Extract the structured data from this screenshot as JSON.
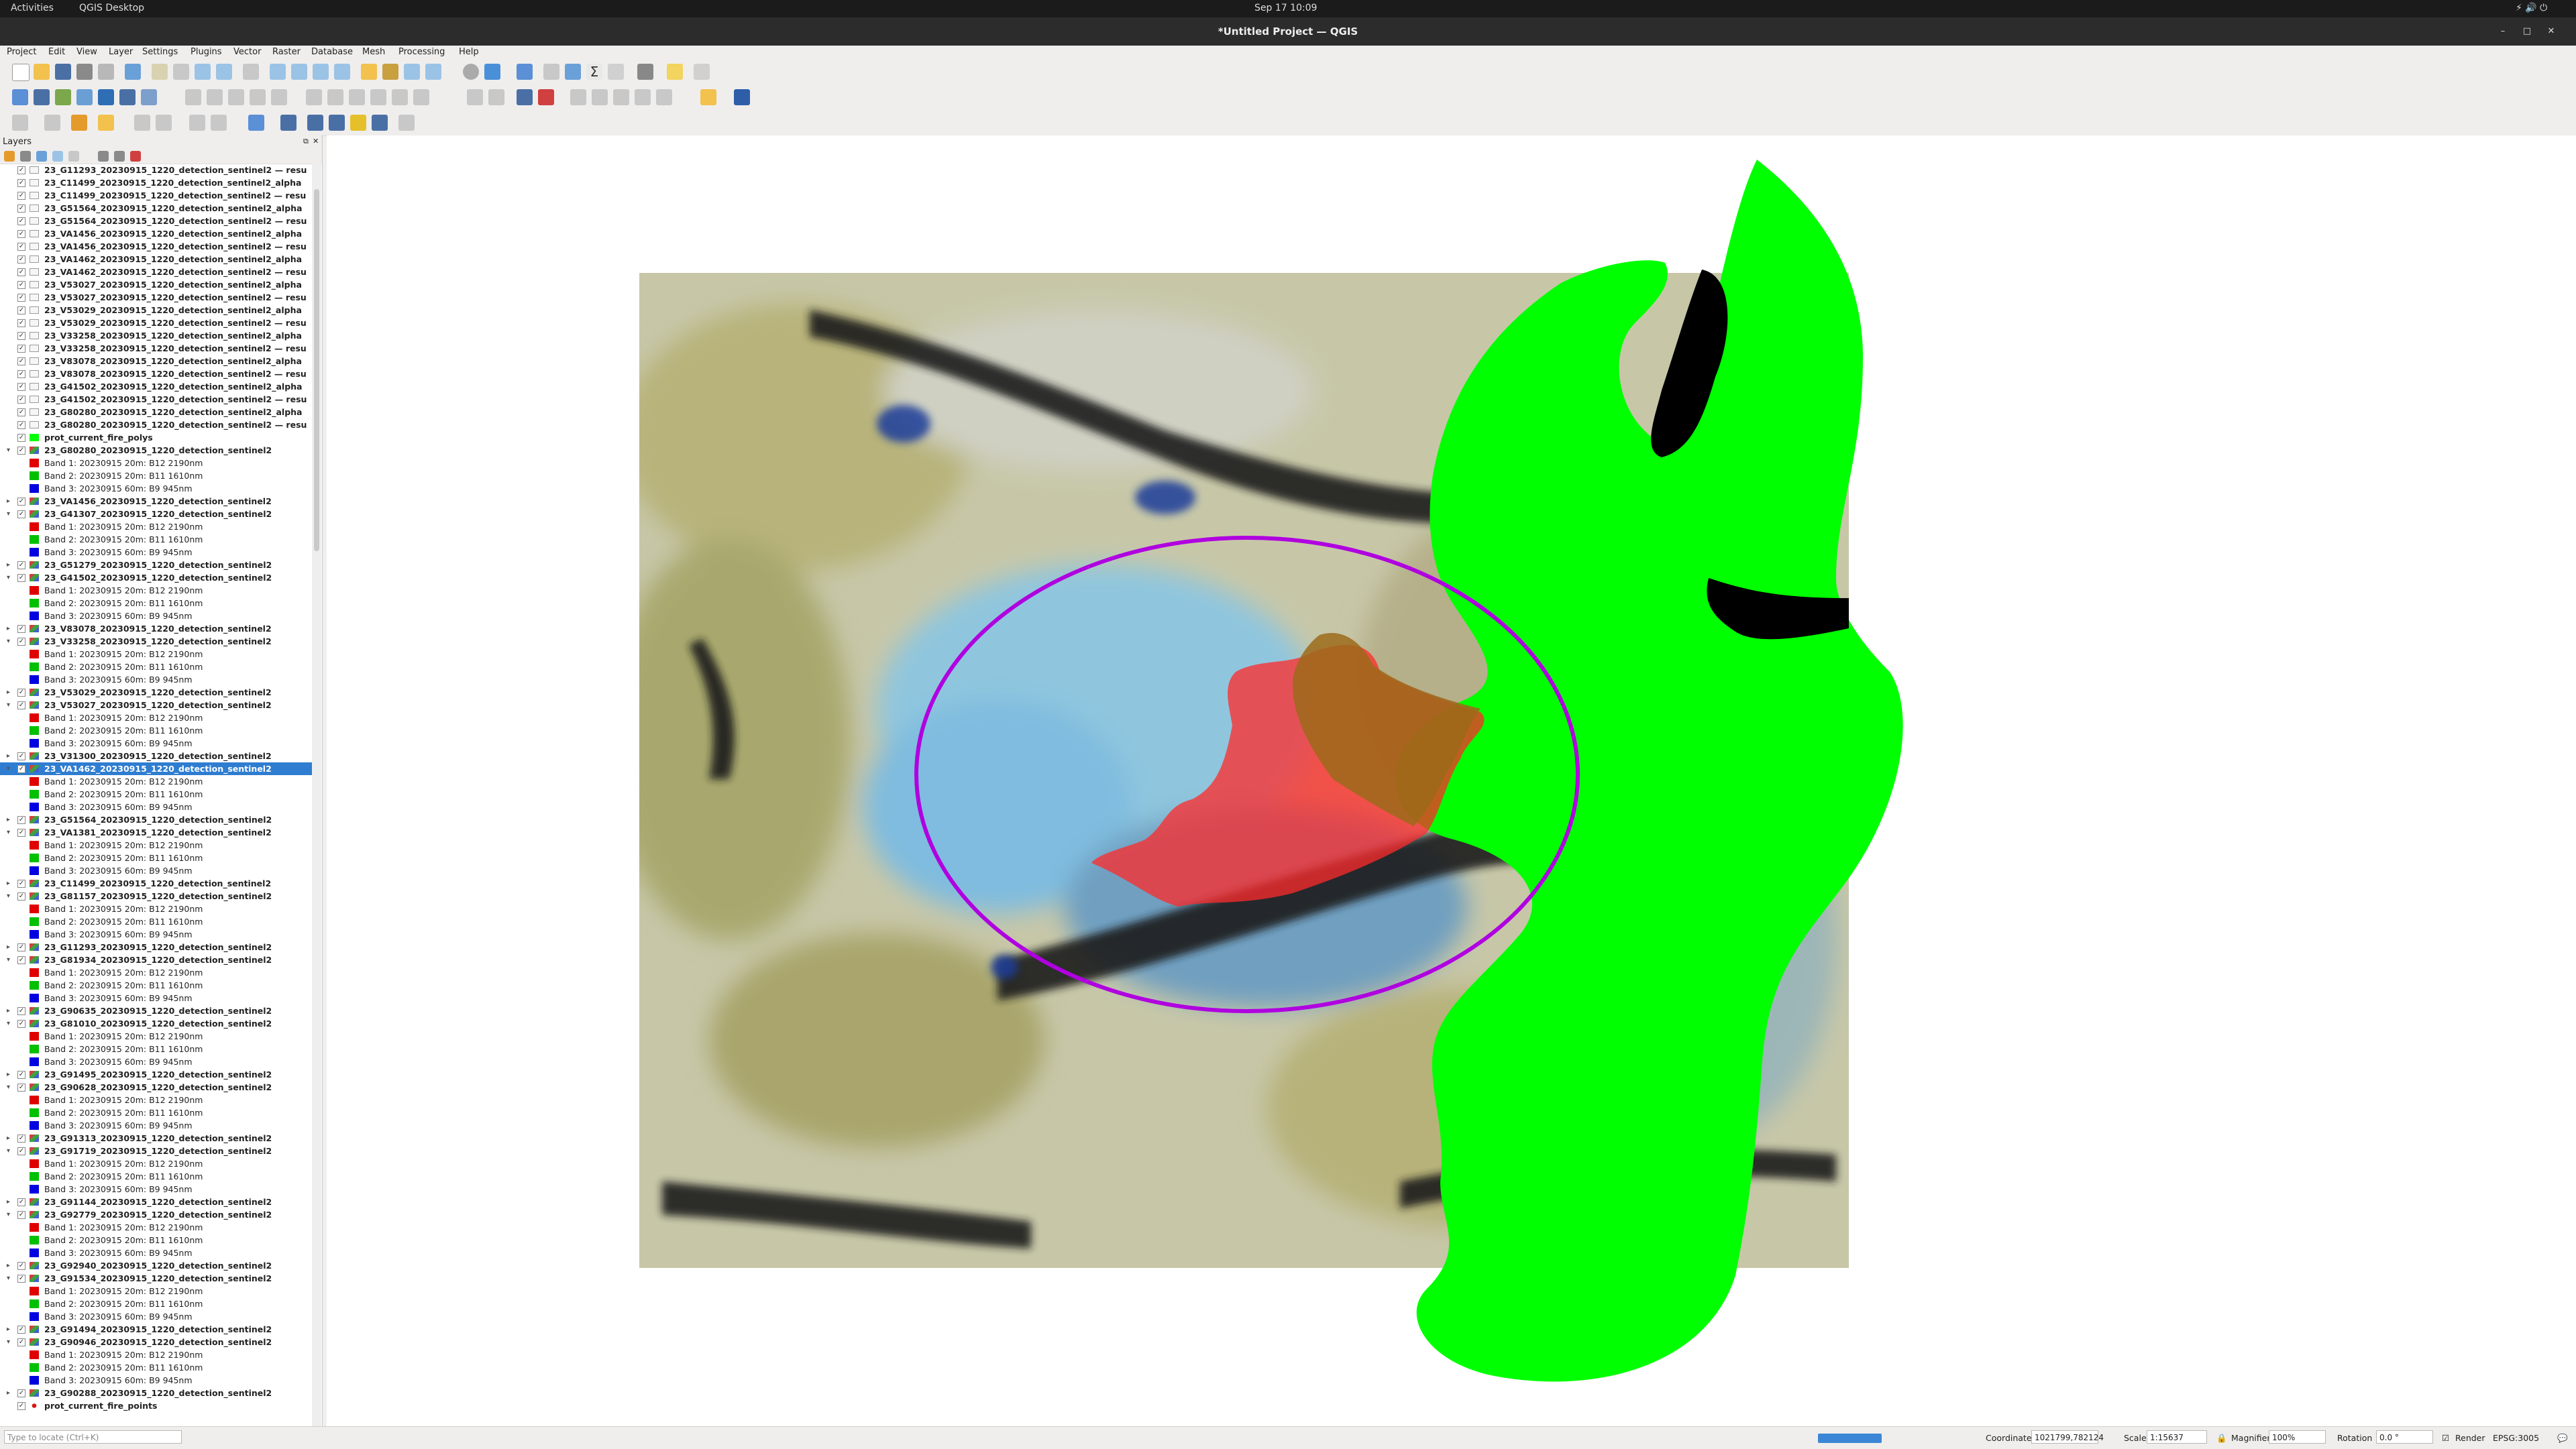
{
  "system_bar": {
    "activities": "Activities",
    "app": "QGIS Desktop",
    "clock": "Sep 17  10:09"
  },
  "window": {
    "title": "*Untitled Project — QGIS"
  },
  "menu": [
    "Project",
    "Edit",
    "View",
    "Layer",
    "Settings",
    "Plugins",
    "Vector",
    "Raster",
    "Database",
    "Mesh",
    "Processing",
    "Help"
  ],
  "layers_panel": {
    "title": "Layers"
  },
  "layers": [
    {
      "type": "layer",
      "name": "23_G11293_20230915_1220_detection_sentinel2 — resu",
      "icon": "mask-layer-icon"
    },
    {
      "type": "layer",
      "name": "23_C11499_20230915_1220_detection_sentinel2_alpha",
      "icon": "mask-layer-icon"
    },
    {
      "type": "layer",
      "name": "23_C11499_20230915_1220_detection_sentinel2 — resu",
      "icon": "mask-layer-icon"
    },
    {
      "type": "layer",
      "name": "23_G51564_20230915_1220_detection_sentinel2_alpha",
      "icon": "mask-layer-icon"
    },
    {
      "type": "layer",
      "name": "23_G51564_20230915_1220_detection_sentinel2 — resu",
      "icon": "mask-layer-icon"
    },
    {
      "type": "layer",
      "name": "23_VA1456_20230915_1220_detection_sentinel2_alpha",
      "icon": "mask-layer-icon"
    },
    {
      "type": "layer",
      "name": "23_VA1456_20230915_1220_detection_sentinel2 — resu",
      "icon": "mask-layer-icon"
    },
    {
      "type": "layer",
      "name": "23_VA1462_20230915_1220_detection_sentinel2_alpha",
      "icon": "mask-layer-icon"
    },
    {
      "type": "layer",
      "name": "23_VA1462_20230915_1220_detection_sentinel2 — resu",
      "icon": "mask-layer-icon"
    },
    {
      "type": "layer",
      "name": "23_V53027_20230915_1220_detection_sentinel2_alpha",
      "icon": "mask-layer-icon"
    },
    {
      "type": "layer",
      "name": "23_V53027_20230915_1220_detection_sentinel2 — resu",
      "icon": "mask-layer-icon"
    },
    {
      "type": "layer",
      "name": "23_V53029_20230915_1220_detection_sentinel2_alpha",
      "icon": "mask-layer-icon"
    },
    {
      "type": "layer",
      "name": "23_V53029_20230915_1220_detection_sentinel2 — resu",
      "icon": "mask-layer-icon"
    },
    {
      "type": "layer",
      "name": "23_V33258_20230915_1220_detection_sentinel2_alpha",
      "icon": "mask-layer-icon"
    },
    {
      "type": "layer",
      "name": "23_V33258_20230915_1220_detection_sentinel2 — resu",
      "icon": "mask-layer-icon"
    },
    {
      "type": "layer",
      "name": "23_V83078_20230915_1220_detection_sentinel2_alpha",
      "icon": "mask-layer-icon"
    },
    {
      "type": "layer",
      "name": "23_V83078_20230915_1220_detection_sentinel2 — resu",
      "icon": "mask-layer-icon"
    },
    {
      "type": "layer",
      "name": "23_G41502_20230915_1220_detection_sentinel2_alpha",
      "icon": "mask-layer-icon"
    },
    {
      "type": "layer",
      "name": "23_G41502_20230915_1220_detection_sentinel2 — resu",
      "icon": "mask-layer-icon"
    },
    {
      "type": "layer",
      "name": "23_G80280_20230915_1220_detection_sentinel2_alpha",
      "icon": "mask-layer-icon"
    },
    {
      "type": "layer",
      "name": "23_G80280_20230915_1220_detection_sentinel2 — resu",
      "icon": "mask-layer-icon"
    },
    {
      "type": "layer",
      "name": "prot_current_fire_polys",
      "icon": "polygon-layer-icon",
      "color": "#00ff00"
    },
    {
      "type": "raster",
      "name": "23_G80280_20230915_1220_detection_sentinel2",
      "expanded": true
    },
    {
      "type": "band",
      "name": "Band 1: 20230915 20m: B12 2190nm",
      "color": "#e00000"
    },
    {
      "type": "band",
      "name": "Band 2: 20230915 20m: B11 1610nm",
      "color": "#00c000"
    },
    {
      "type": "band",
      "name": "Band 3: 20230915 60m: B9 945nm",
      "color": "#0000e0"
    },
    {
      "type": "raster",
      "name": "23_VA1456_20230915_1220_detection_sentinel2",
      "expanded": false
    },
    {
      "type": "raster",
      "name": "23_G41307_20230915_1220_detection_sentinel2",
      "expanded": true
    },
    {
      "type": "band",
      "name": "Band 1: 20230915 20m: B12 2190nm",
      "color": "#e00000"
    },
    {
      "type": "band",
      "name": "Band 2: 20230915 20m: B11 1610nm",
      "color": "#00c000"
    },
    {
      "type": "band",
      "name": "Band 3: 20230915 60m: B9 945nm",
      "color": "#0000e0"
    },
    {
      "type": "raster",
      "name": "23_G51279_20230915_1220_detection_sentinel2",
      "expanded": false
    },
    {
      "type": "raster",
      "name": "23_G41502_20230915_1220_detection_sentinel2",
      "expanded": true
    },
    {
      "type": "band",
      "name": "Band 1: 20230915 20m: B12 2190nm",
      "color": "#e00000"
    },
    {
      "type": "band",
      "name": "Band 2: 20230915 20m: B11 1610nm",
      "color": "#00c000"
    },
    {
      "type": "band",
      "name": "Band 3: 20230915 60m: B9 945nm",
      "color": "#0000e0"
    },
    {
      "type": "raster",
      "name": "23_V83078_20230915_1220_detection_sentinel2",
      "expanded": false
    },
    {
      "type": "raster",
      "name": "23_V33258_20230915_1220_detection_sentinel2",
      "expanded": true
    },
    {
      "type": "band",
      "name": "Band 1: 20230915 20m: B12 2190nm",
      "color": "#e00000"
    },
    {
      "type": "band",
      "name": "Band 2: 20230915 20m: B11 1610nm",
      "color": "#00c000"
    },
    {
      "type": "band",
      "name": "Band 3: 20230915 60m: B9 945nm",
      "color": "#0000e0"
    },
    {
      "type": "raster",
      "name": "23_V53029_20230915_1220_detection_sentinel2",
      "expanded": false
    },
    {
      "type": "raster",
      "name": "23_V53027_20230915_1220_detection_sentinel2",
      "expanded": true
    },
    {
      "type": "band",
      "name": "Band 1: 20230915 20m: B12 2190nm",
      "color": "#e00000"
    },
    {
      "type": "band",
      "name": "Band 2: 20230915 20m: B11 1610nm",
      "color": "#00c000"
    },
    {
      "type": "band",
      "name": "Band 3: 20230915 60m: B9 945nm",
      "color": "#0000e0"
    },
    {
      "type": "raster",
      "name": "23_V31300_20230915_1220_detection_sentinel2",
      "expanded": false
    },
    {
      "type": "raster",
      "name": "23_VA1462_20230915_1220_detection_sentinel2",
      "expanded": true,
      "selected": true
    },
    {
      "type": "band",
      "name": "Band 1: 20230915 20m: B12 2190nm",
      "color": "#e00000"
    },
    {
      "type": "band",
      "name": "Band 2: 20230915 20m: B11 1610nm",
      "color": "#00c000"
    },
    {
      "type": "band",
      "name": "Band 3: 20230915 60m: B9 945nm",
      "color": "#0000e0"
    },
    {
      "type": "raster",
      "name": "23_G51564_20230915_1220_detection_sentinel2",
      "expanded": false
    },
    {
      "type": "raster",
      "name": "23_VA1381_20230915_1220_detection_sentinel2",
      "expanded": true
    },
    {
      "type": "band",
      "name": "Band 1: 20230915 20m: B12 2190nm",
      "color": "#e00000"
    },
    {
      "type": "band",
      "name": "Band 2: 20230915 20m: B11 1610nm",
      "color": "#00c000"
    },
    {
      "type": "band",
      "name": "Band 3: 20230915 60m: B9 945nm",
      "color": "#0000e0"
    },
    {
      "type": "raster",
      "name": "23_C11499_20230915_1220_detection_sentinel2",
      "expanded": false
    },
    {
      "type": "raster",
      "name": "23_G81157_20230915_1220_detection_sentinel2",
      "expanded": true
    },
    {
      "type": "band",
      "name": "Band 1: 20230915 20m: B12 2190nm",
      "color": "#e00000"
    },
    {
      "type": "band",
      "name": "Band 2: 20230915 20m: B11 1610nm",
      "color": "#00c000"
    },
    {
      "type": "band",
      "name": "Band 3: 20230915 60m: B9 945nm",
      "color": "#0000e0"
    },
    {
      "type": "raster",
      "name": "23_G11293_20230915_1220_detection_sentinel2",
      "expanded": false
    },
    {
      "type": "raster",
      "name": "23_G81934_20230915_1220_detection_sentinel2",
      "expanded": true
    },
    {
      "type": "band",
      "name": "Band 1: 20230915 20m: B12 2190nm",
      "color": "#e00000"
    },
    {
      "type": "band",
      "name": "Band 2: 20230915 20m: B11 1610nm",
      "color": "#00c000"
    },
    {
      "type": "band",
      "name": "Band 3: 20230915 60m: B9 945nm",
      "color": "#0000e0"
    },
    {
      "type": "raster",
      "name": "23_G90635_20230915_1220_detection_sentinel2",
      "expanded": false
    },
    {
      "type": "raster",
      "name": "23_G81010_20230915_1220_detection_sentinel2",
      "expanded": true
    },
    {
      "type": "band",
      "name": "Band 1: 20230915 20m: B12 2190nm",
      "color": "#e00000"
    },
    {
      "type": "band",
      "name": "Band 2: 20230915 20m: B11 1610nm",
      "color": "#00c000"
    },
    {
      "type": "band",
      "name": "Band 3: 20230915 60m: B9 945nm",
      "color": "#0000e0"
    },
    {
      "type": "raster",
      "name": "23_G91495_20230915_1220_detection_sentinel2",
      "expanded": false
    },
    {
      "type": "raster",
      "name": "23_G90628_20230915_1220_detection_sentinel2",
      "expanded": true
    },
    {
      "type": "band",
      "name": "Band 1: 20230915 20m: B12 2190nm",
      "color": "#e00000"
    },
    {
      "type": "band",
      "name": "Band 2: 20230915 20m: B11 1610nm",
      "color": "#00c000"
    },
    {
      "type": "band",
      "name": "Band 3: 20230915 60m: B9 945nm",
      "color": "#0000e0"
    },
    {
      "type": "raster",
      "name": "23_G91313_20230915_1220_detection_sentinel2",
      "expanded": false
    },
    {
      "type": "raster",
      "name": "23_G91719_20230915_1220_detection_sentinel2",
      "expanded": true
    },
    {
      "type": "band",
      "name": "Band 1: 20230915 20m: B12 2190nm",
      "color": "#e00000"
    },
    {
      "type": "band",
      "name": "Band 2: 20230915 20m: B11 1610nm",
      "color": "#00c000"
    },
    {
      "type": "band",
      "name": "Band 3: 20230915 60m: B9 945nm",
      "color": "#0000e0"
    },
    {
      "type": "raster",
      "name": "23_G91144_20230915_1220_detection_sentinel2",
      "expanded": false
    },
    {
      "type": "raster",
      "name": "23_G92779_20230915_1220_detection_sentinel2",
      "expanded": true
    },
    {
      "type": "band",
      "name": "Band 1: 20230915 20m: B12 2190nm",
      "color": "#e00000"
    },
    {
      "type": "band",
      "name": "Band 2: 20230915 20m: B11 1610nm",
      "color": "#00c000"
    },
    {
      "type": "band",
      "name": "Band 3: 20230915 60m: B9 945nm",
      "color": "#0000e0"
    },
    {
      "type": "raster",
      "name": "23_G92940_20230915_1220_detection_sentinel2",
      "expanded": false
    },
    {
      "type": "raster",
      "name": "23_G91534_20230915_1220_detection_sentinel2",
      "expanded": true
    },
    {
      "type": "band",
      "name": "Band 1: 20230915 20m: B12 2190nm",
      "color": "#e00000"
    },
    {
      "type": "band",
      "name": "Band 2: 20230915 20m: B11 1610nm",
      "color": "#00c000"
    },
    {
      "type": "band",
      "name": "Band 3: 20230915 60m: B9 945nm",
      "color": "#0000e0"
    },
    {
      "type": "raster",
      "name": "23_G91494_20230915_1220_detection_sentinel2",
      "expanded": false
    },
    {
      "type": "raster",
      "name": "23_G90946_20230915_1220_detection_sentinel2",
      "expanded": true
    },
    {
      "type": "band",
      "name": "Band 1: 20230915 20m: B12 2190nm",
      "color": "#e00000"
    },
    {
      "type": "band",
      "name": "Band 2: 20230915 20m: B11 1610nm",
      "color": "#00c000"
    },
    {
      "type": "band",
      "name": "Band 3: 20230915 60m: B9 945nm",
      "color": "#0000e0"
    },
    {
      "type": "raster",
      "name": "23_G90288_20230915_1220_detection_sentinel2",
      "expanded": false
    },
    {
      "type": "layer",
      "name": "prot_current_fire_points",
      "icon": "point-layer-icon",
      "color": "#e01010"
    }
  ],
  "status": {
    "locate_placeholder": "Type to locate (Ctrl+K)",
    "coordinate_label": "Coordinate",
    "coordinate": "1021799,782124",
    "scale_label": "Scale",
    "scale": "1:15637",
    "magnifier_label": "Magnifier",
    "magnifier": "100%",
    "rotation_label": "Rotation",
    "rotation": "0.0 °",
    "render_label": "Render",
    "crs": "EPSG:3005"
  },
  "colors": {
    "fire_polys_fill": "#00ff00",
    "fire_points_fill": "#ff2020",
    "ellipse_stroke": "#b000e0",
    "selection": "#2f7dd1"
  }
}
